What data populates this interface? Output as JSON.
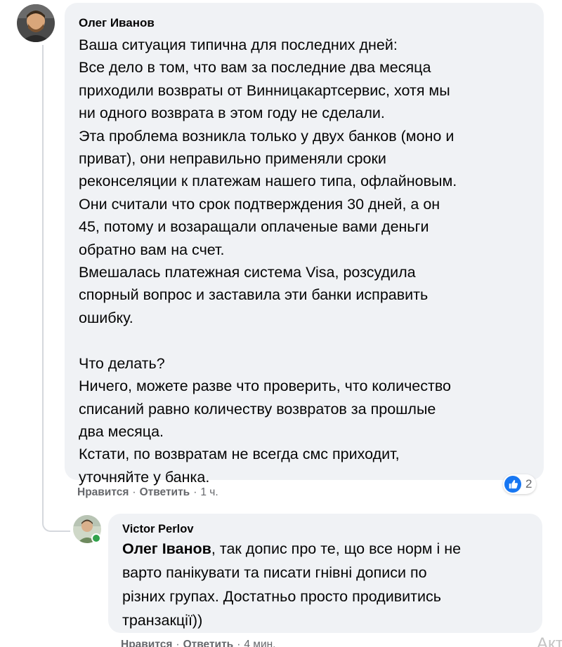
{
  "comment": {
    "author": "Олег Иванов",
    "body": "Ваша ситуация типична для последних дней:\nВсе дело в том, что вам за последние два месяца\nприходили возвраты от Винницакартсервис, хотя мы\nни одного возврата в этом году не сделали.\nЭта проблема возникла только у двух банков (моно и\nприват), они неправильно применяли сроки\nреконселяции к платежам нашего типа, офлайновым.\nОни считали что срок подтверждения 30 дней, а он\n45, потому и возаращали оплаченые вами деньги\nобратно вам на счет.\nВмешалась платежная система Visa, розсудила\nспорный вопрос и заставила эти банки исправить\nошибку.\n\nЧто делать?\nНичего, можете разве что проверить, что количество\nсписаний равно количеству возвратов за прошлые\nдва месяца.\nКстати, по возвратам не всегда смс приходит,\nуточняйте у банка.",
    "like_label": "Нравится",
    "reply_label": "Ответить",
    "time": "1 ч.",
    "reaction_count": "2"
  },
  "reply": {
    "author": "Victor Perlov",
    "mention": "Олег Іванов",
    "body": ", так допис про те, що все норм і не\nварто панікувати та писати гнівні дописи по\nрізних групах. Достатньо просто продивитись\nтранзакції))",
    "like_label": "Нравится",
    "reply_label": "Ответить",
    "time": "4 мин."
  },
  "overlay": {
    "watermark": "Акти"
  },
  "colors": {
    "bubble": "#f0f2f5",
    "text": "#050505",
    "meta": "#65676b",
    "like": "#1877f2",
    "online": "#31a24c"
  },
  "icons": {
    "reaction": "like-icon",
    "presence": "online-dot"
  }
}
